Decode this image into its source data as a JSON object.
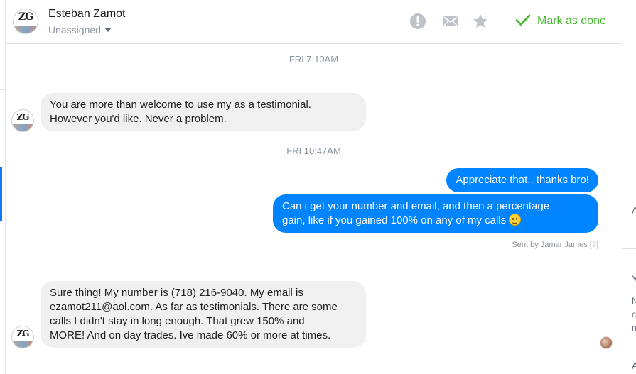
{
  "header": {
    "contact_name": "Esteban Zamot",
    "assign_label": "Unassigned",
    "avatar_initials": "ZG",
    "mark_done_label": "Mark as done",
    "icons": [
      "alert-icon",
      "mail-icon",
      "star-icon",
      "checkmark-icon"
    ],
    "accent_color": "#42b72a"
  },
  "thread": {
    "timestamps": [
      "FRI 7:10AM",
      "FRI 10:47AM"
    ],
    "messages": [
      {
        "direction": "in",
        "lines": [
          "You are more than welcome to use my as a testimonial.",
          "However you'd like. Never a problem."
        ]
      },
      {
        "direction": "out",
        "lines": [
          "Appreciate that.. thanks bro!"
        ]
      },
      {
        "direction": "out",
        "lines": [
          "Can i get your number and email, and then a percentage",
          "gain, like if you gained 100% on any of my calls"
        ],
        "emoji": "slightly-smiling-face"
      },
      {
        "direction": "in",
        "lines": [
          "Sure thing! My number is (718) 216-9040. My email is",
          "ezamot211@aol.com. As far as testimonials. There are some",
          "calls I didn't stay in long enough. That grew 150% and",
          "MORE! And on day trades. Ive made 60% or more at times."
        ]
      }
    ],
    "sent_by": "Sent by Jamar James",
    "sent_by_help": "[?]",
    "bubble_colors": {
      "incoming": "#f1f0f0",
      "outgoing": "#0084ff"
    }
  },
  "right_panel": {
    "clipped_letters": [
      "A",
      "Y",
      "N",
      "c",
      "n",
      "A"
    ]
  }
}
